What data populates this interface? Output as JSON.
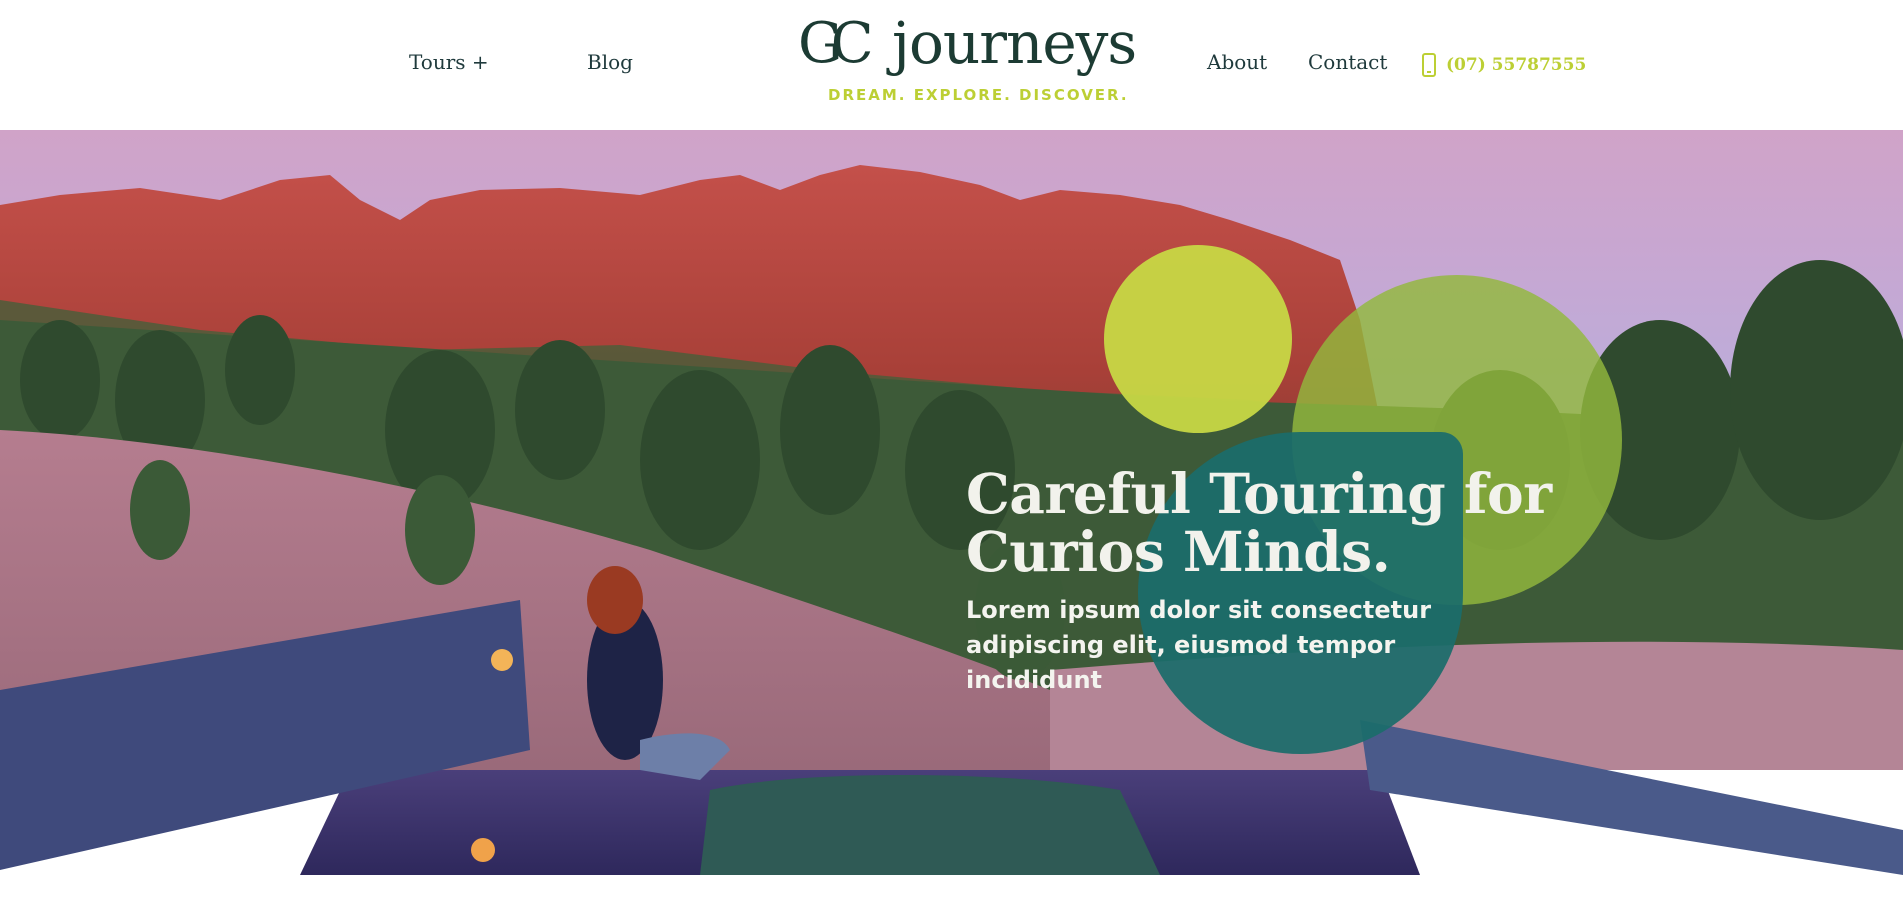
{
  "header": {
    "nav_left": [
      {
        "label": "Tours +"
      },
      {
        "label": "Blog"
      }
    ],
    "logo": {
      "mark": "GC",
      "word": "journeys",
      "tagline": "DREAM. EXPLORE. DISCOVER."
    },
    "nav_right": [
      {
        "label": "About"
      },
      {
        "label": "Contact"
      }
    ],
    "phone": {
      "icon": "mobile-phone-icon",
      "number": "(07) 55787555"
    }
  },
  "hero": {
    "title_line1": "Careful Touring for",
    "title_line2": "Curios Minds.",
    "subtitle_line1": "Lorem ipsum dolor sit consectetur",
    "subtitle_line2": "adipiscing elit, eiusmod tempor incididunt"
  },
  "colors": {
    "brand_dark": "#1c3b33",
    "accent_lime": "#bccf34",
    "circle_lime": "#c7d845",
    "circle_green": "#93b83d",
    "circle_teal": "#1b6d6a"
  }
}
